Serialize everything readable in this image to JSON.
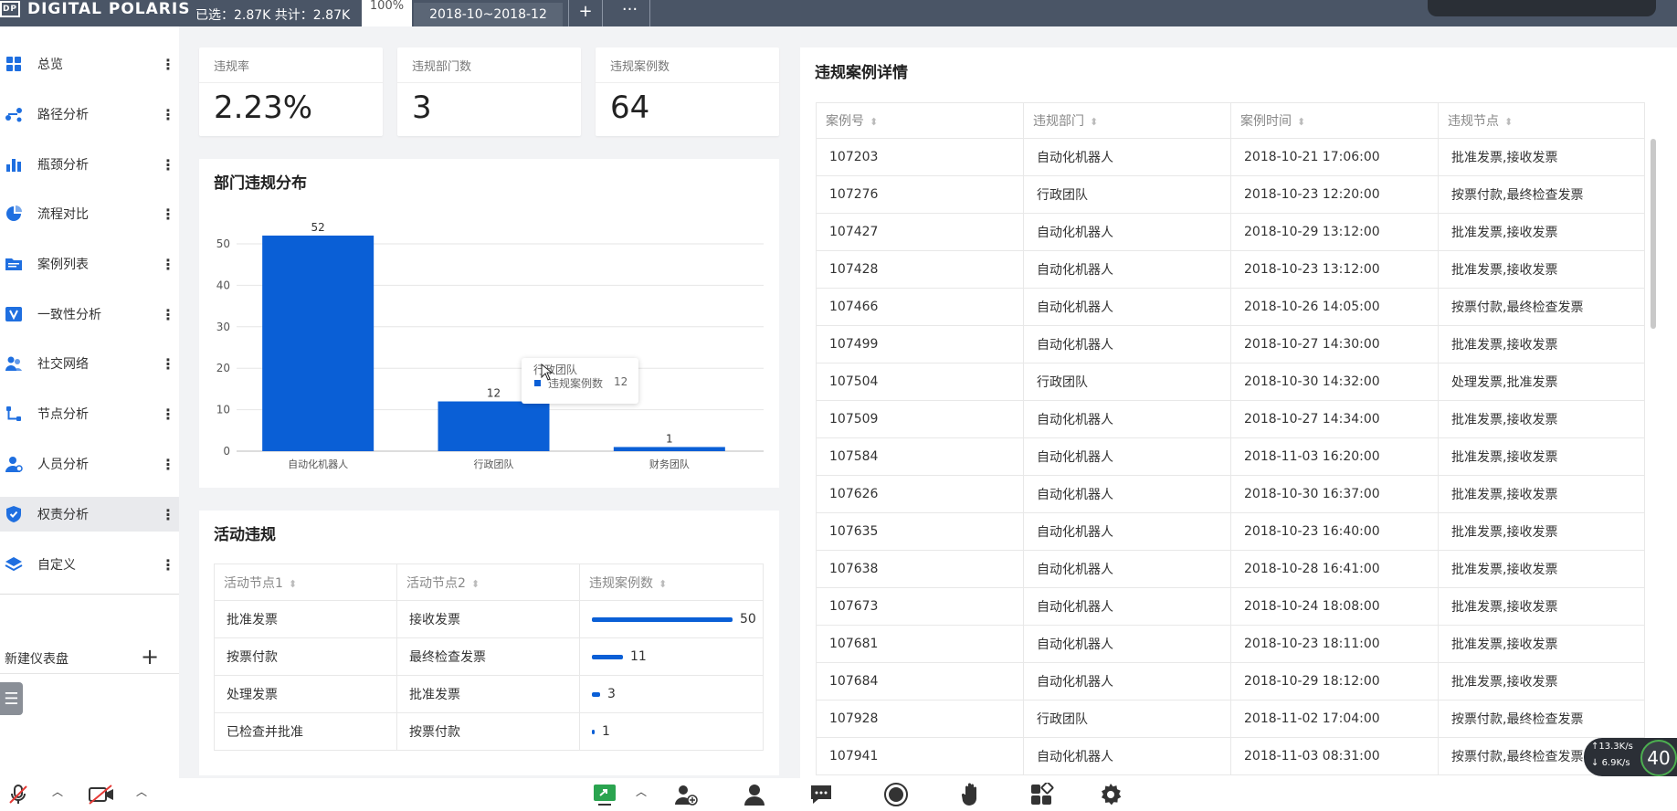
{
  "topbar": {
    "logo_mark": "DP",
    "logo_text": "DIGITAL POLARIS",
    "selection_text": "已选：2.87K 共计：2.87K",
    "zoom": "100%",
    "date_range": "2018-10~2018-12",
    "add_label": "+",
    "more_label": "···"
  },
  "sidebar": {
    "items": [
      {
        "label": "总览",
        "icon": "grid-icon",
        "color": "#1f6fe0"
      },
      {
        "label": "路径分析",
        "icon": "path-icon",
        "color": "#1f6fe0"
      },
      {
        "label": "瓶颈分析",
        "icon": "bar-chart-icon",
        "color": "#1f6fe0"
      },
      {
        "label": "流程对比",
        "icon": "pie-icon",
        "color": "#1f6fe0"
      },
      {
        "label": "案例列表",
        "icon": "folder-icon",
        "color": "#1f6fe0"
      },
      {
        "label": "一致性分析",
        "icon": "check-icon",
        "color": "#1f6fe0"
      },
      {
        "label": "社交网络",
        "icon": "people-icon",
        "color": "#1f6fe0"
      },
      {
        "label": "节点分析",
        "icon": "node-icon",
        "color": "#1f6fe0"
      },
      {
        "label": "人员分析",
        "icon": "person-icon",
        "color": "#1f6fe0"
      },
      {
        "label": "权责分析",
        "icon": "shield-icon",
        "color": "#1f6fe0"
      },
      {
        "label": "自定义",
        "icon": "layers-icon",
        "color": "#1f6fe0"
      }
    ],
    "active_index": 9,
    "more_label": "⋮",
    "new_dashboard": "新建仪表盘",
    "new_plus": "+",
    "collapse_label": "☰"
  },
  "kpis": [
    {
      "label": "违规率",
      "value": "2.23%"
    },
    {
      "label": "违规部门数",
      "value": "3"
    },
    {
      "label": "违规案例数",
      "value": "64"
    }
  ],
  "dept_chart": {
    "title": "部门违规分布"
  },
  "chart_data": {
    "type": "bar",
    "categories": [
      "自动化机器人",
      "行政团队",
      "财务团队"
    ],
    "values": [
      52,
      12,
      1
    ],
    "ylim": [
      0,
      50
    ],
    "yticks": [
      0,
      10,
      20,
      30,
      40,
      50
    ],
    "grid": true,
    "color": "#0a5fd6",
    "tooltip": {
      "title": "行政团队",
      "series": "违规案例数",
      "value": "12"
    }
  },
  "activity": {
    "title": "活动违规",
    "headers": [
      "活动节点1",
      "活动节点2",
      "违规案例数"
    ],
    "rows": [
      {
        "a": "批准发票",
        "b": "接收发票",
        "count": 50
      },
      {
        "a": "按票付款",
        "b": "最终检查发票",
        "count": 11
      },
      {
        "a": "处理发票",
        "b": "批准发票",
        "count": 3
      },
      {
        "a": "已检查并批准",
        "b": "按票付款",
        "count": 1
      }
    ],
    "max": 50
  },
  "cases": {
    "title": "违规案例详情",
    "headers": [
      "案例号",
      "违规部门",
      "案例时间",
      "违规节点"
    ],
    "rows": [
      [
        "107203",
        "自动化机器人",
        "2018-10-21 17:06:00",
        "批准发票,接收发票"
      ],
      [
        "107276",
        "行政团队",
        "2018-10-23 12:20:00",
        "按票付款,最终检查发票"
      ],
      [
        "107427",
        "自动化机器人",
        "2018-10-29 13:12:00",
        "批准发票,接收发票"
      ],
      [
        "107428",
        "自动化机器人",
        "2018-10-23 13:12:00",
        "批准发票,接收发票"
      ],
      [
        "107466",
        "自动化机器人",
        "2018-10-26 14:05:00",
        "按票付款,最终检查发票"
      ],
      [
        "107499",
        "自动化机器人",
        "2018-10-27 14:30:00",
        "批准发票,接收发票"
      ],
      [
        "107504",
        "行政团队",
        "2018-10-30 14:32:00",
        "处理发票,批准发票"
      ],
      [
        "107509",
        "自动化机器人",
        "2018-10-27 14:34:00",
        "批准发票,接收发票"
      ],
      [
        "107584",
        "自动化机器人",
        "2018-11-03 16:20:00",
        "批准发票,接收发票"
      ],
      [
        "107626",
        "自动化机器人",
        "2018-10-30 16:37:00",
        "批准发票,接收发票"
      ],
      [
        "107635",
        "自动化机器人",
        "2018-10-23 16:40:00",
        "批准发票,接收发票"
      ],
      [
        "107638",
        "自动化机器人",
        "2018-10-28 16:41:00",
        "批准发票,接收发票"
      ],
      [
        "107673",
        "自动化机器人",
        "2018-10-24 18:08:00",
        "批准发票,接收发票"
      ],
      [
        "107681",
        "自动化机器人",
        "2018-10-23 18:11:00",
        "批准发票,接收发票"
      ],
      [
        "107684",
        "自动化机器人",
        "2018-10-29 18:12:00",
        "批准发票,接收发票"
      ],
      [
        "107928",
        "行政团队",
        "2018-11-02 17:04:00",
        "按票付款,最终检查发票"
      ],
      [
        "107941",
        "自动化机器人",
        "2018-11-03 08:31:00",
        "按票付款,最终检查发票"
      ]
    ]
  },
  "netmeter": {
    "up": "13.3",
    "down": "6.9",
    "unit": "K/s",
    "pct": "40"
  }
}
